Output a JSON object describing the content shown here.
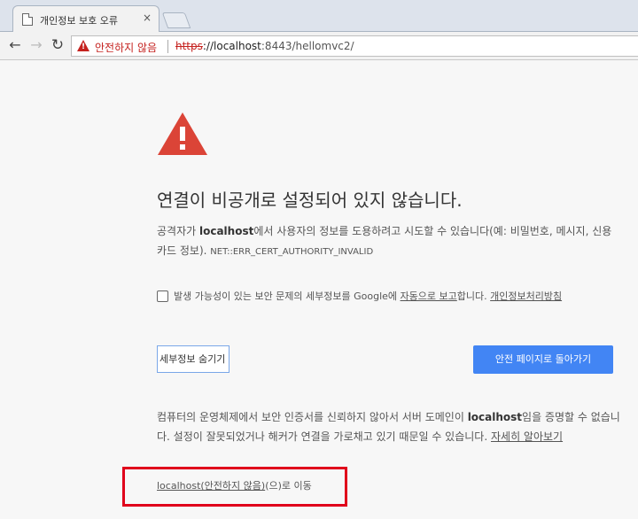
{
  "tab": {
    "title": "개인정보 보호 오류",
    "close": "×"
  },
  "toolbar": {
    "back": "←",
    "forward": "→",
    "reload": "↻",
    "security_label": "안전하지 않음",
    "url_scheme": "https",
    "url_host": "://localhost",
    "url_rest": ":8443/hellomvc2/"
  },
  "error": {
    "heading": "연결이 비공개로 설정되어 있지 않습니다.",
    "desc_before": "공격자가 ",
    "desc_host": "localhost",
    "desc_after": "에서 사용자의 정보를 도용하려고 시도할 수 있습니다(예: 비밀번호, 메시지, 신용카드 정보). ",
    "error_code": "NET::ERR_CERT_AUTHORITY_INVALID"
  },
  "report": {
    "text_before": "발생 가능성이 있는 보안 문제의 세부정보를 Google에 ",
    "link_auto_report": "자동으로 보고",
    "text_after": "합니다. ",
    "link_privacy": "개인정보처리방침"
  },
  "buttons": {
    "hide_details": "세부정보 숨기기",
    "back_to_safety": "안전 페이지로 돌아가기"
  },
  "details": {
    "text_before": "컴퓨터의 운영체제에서 보안 인증서를 신뢰하지 않아서 서버 도메인이 ",
    "host": "localhost",
    "text_after": "임을 증명할 수 없습니다. 설정이 잘못되었거나 해커가 연결을 가로채고 있기 때문일 수 있습니다. ",
    "learn_more": "자세히 알아보기"
  },
  "proceed": {
    "link": "localhost(안전하지 않음)",
    "suffix": "(으)로 이동"
  }
}
